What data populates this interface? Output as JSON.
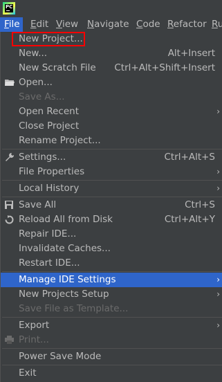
{
  "menubar": {
    "items": [
      {
        "label": "File",
        "u": "F",
        "rest": "ile"
      },
      {
        "label": "Edit",
        "u": "E",
        "rest": "dit"
      },
      {
        "label": "View",
        "u": "V",
        "rest": "iew"
      },
      {
        "label": "Navigate",
        "u": "N",
        "rest": "avigate"
      },
      {
        "label": "Code",
        "u": "C",
        "rest": "ode"
      },
      {
        "label": "Refactor",
        "u": "R",
        "rest": "efactor"
      },
      {
        "label": "Ru",
        "u": "R",
        "rest": "u"
      }
    ]
  },
  "file_menu": {
    "new_project": "New Project...",
    "new": "New...",
    "new_shortcut": "Alt+Insert",
    "new_scratch": "New Scratch File",
    "new_scratch_shortcut": "Ctrl+Alt+Shift+Insert",
    "open": "Open...",
    "save_as": "Save As...",
    "open_recent": "Open Recent",
    "close_project": "Close Project",
    "rename_project": "Rename Project...",
    "settings": "Settings...",
    "settings_shortcut": "Ctrl+Alt+S",
    "file_properties": "File Properties",
    "local_history": "Local History",
    "save_all": "Save All",
    "save_all_shortcut": "Ctrl+S",
    "reload": "Reload All from Disk",
    "reload_shortcut": "Ctrl+Alt+Y",
    "repair_ide": "Repair IDE...",
    "invalidate_caches": "Invalidate Caches...",
    "restart_ide": "Restart IDE...",
    "manage_ide_settings": "Manage IDE Settings",
    "new_projects_setup": "New Projects Setup",
    "save_file_as_template": "Save File as Template...",
    "export": "Export",
    "print": "Print...",
    "power_save_mode": "Power Save Mode",
    "exit": "Exit"
  },
  "icons": {
    "folder": "folder-icon",
    "wrench": "wrench-icon",
    "save": "save-icon",
    "reload": "reload-icon",
    "print": "print-icon"
  }
}
